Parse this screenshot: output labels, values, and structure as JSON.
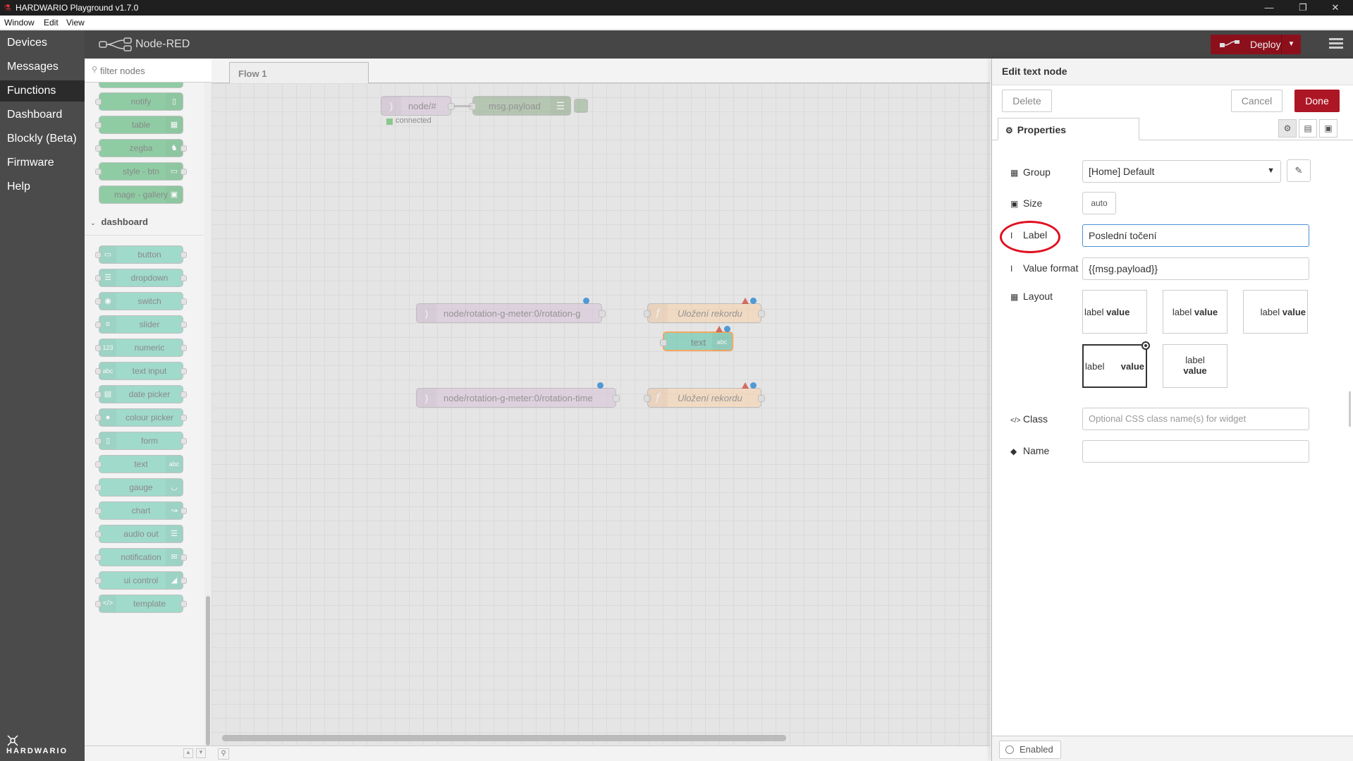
{
  "window": {
    "title": "HARDWARIO Playground v1.7.0",
    "controls": [
      "minimize",
      "maximize",
      "close"
    ]
  },
  "menubar": [
    "Window",
    "Edit",
    "View"
  ],
  "appnav": {
    "items": [
      "Devices",
      "Messages",
      "Functions",
      "Dashboard",
      "Blockly (Beta)",
      "Firmware",
      "Help"
    ],
    "active": "Functions",
    "brand": "HARDWARIO"
  },
  "nodered": {
    "title": "Node-RED",
    "deploy_label": "Deploy",
    "deploy_color": "#8c101c"
  },
  "palette": {
    "filter_placeholder": "filter nodes",
    "upper_nodes": [
      "notify",
      "table",
      "zegba",
      "style - btn",
      "mage - gallery"
    ],
    "dashboard_category": "dashboard",
    "dashboard_nodes": [
      "button",
      "dropdown",
      "switch",
      "slider",
      "numeric",
      "text input",
      "date picker",
      "colour picker",
      "form",
      "text",
      "gauge",
      "chart",
      "audio out",
      "notification",
      "ui control",
      "template"
    ]
  },
  "workspace": {
    "tab": "Flow 1",
    "nodes": {
      "mqtt_in": "node/#",
      "mqtt_status": "connected",
      "debug": "msg.payload",
      "rotation_g": "node/rotation-g-meter:0/rotation-g",
      "func1": "Uložení rekordu",
      "text_node": "text",
      "rotation_time": "node/rotation-g-meter:0/rotation-time",
      "func2": "Uložení rekordu"
    }
  },
  "editor": {
    "title": "Edit text node",
    "delete_label": "Delete",
    "cancel_label": "Cancel",
    "done_label": "Done",
    "tab_label": "Properties",
    "group_label": "Group",
    "group_value": "[Home] Default",
    "size_label": "Size",
    "size_value": "auto",
    "label_label": "Label",
    "label_value": "Poslední točení",
    "value_format_label": "Value format",
    "value_format_value": "{{msg.payload}}",
    "layout_label": "Layout",
    "layout_opts": {
      "label_word": "label",
      "value_word": "value"
    },
    "layout_selected_index": 3,
    "class_label": "Class",
    "class_placeholder": "Optional CSS class name(s) for widget",
    "name_label": "Name",
    "name_value": "",
    "enabled_label": "Enabled",
    "accent_color": "#ad1625",
    "highlight_color": "#e01020"
  }
}
